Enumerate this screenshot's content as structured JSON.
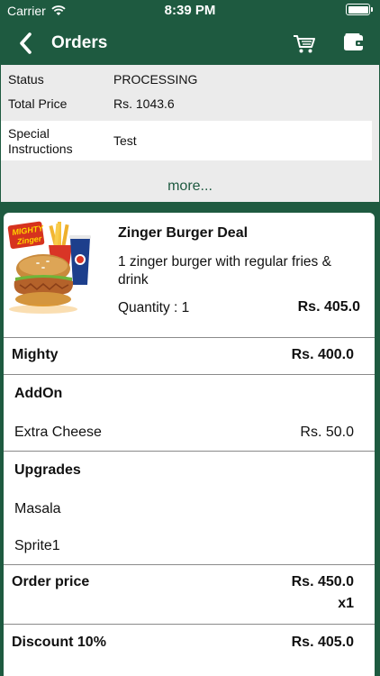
{
  "status_bar": {
    "carrier": "Carrier",
    "time": "8:39 PM"
  },
  "nav": {
    "title": "Orders",
    "icons": {
      "back": "back-chevron-icon",
      "cart": "cart-icon",
      "wallet": "wallet-icon"
    }
  },
  "summary": {
    "status_label": "Status",
    "status_value": "PROCESSING",
    "total_label": "Total Price",
    "total_value": "Rs. 1043.6",
    "instructions_label_line1": "Special",
    "instructions_label_line2": "Instructions",
    "instructions_value": "Test",
    "more_link": "more..."
  },
  "item": {
    "image_logo_text_1": "MIGHTY",
    "image_logo_text_2": "Zinger",
    "title": "Zinger Burger Deal",
    "description": "1 zinger burger with regular fries & drink",
    "quantity": "Quantity : 1",
    "price": "Rs. 405.0"
  },
  "details": {
    "variant_name": "Mighty",
    "variant_price": "Rs. 400.0",
    "addon_header": "AddOn",
    "addon_name": "Extra Cheese",
    "addon_price": "Rs. 50.0",
    "upgrades_header": "Upgrades",
    "upgrade_1": "Masala",
    "upgrade_2": "Sprite1",
    "order_price_label": "Order price",
    "order_price_value": "Rs. 450.0",
    "order_multiplier": "x1",
    "discount_label": "Discount 10%",
    "discount_value": "Rs. 405.0"
  },
  "colors": {
    "brand_green": "#1e5a40",
    "summary_bg": "#ebebeb"
  }
}
